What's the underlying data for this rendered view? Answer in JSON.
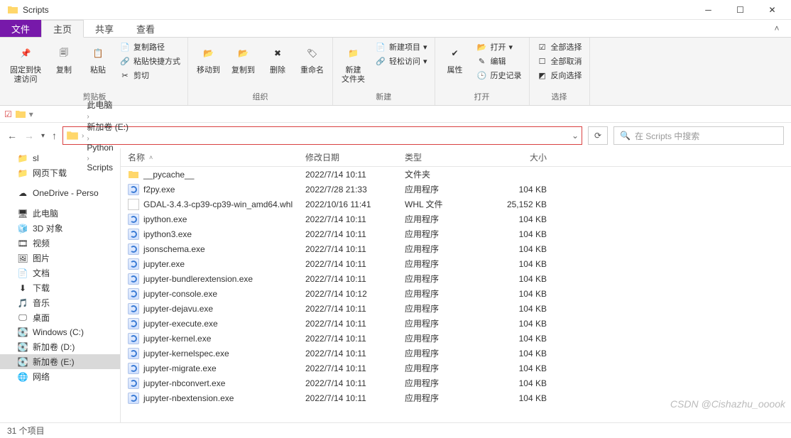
{
  "window": {
    "title": "Scripts"
  },
  "tabs": {
    "file": "文件",
    "home": "主页",
    "share": "共享",
    "view": "查看"
  },
  "ribbon": {
    "pin_quick": "固定到快\n速访问",
    "copy": "复制",
    "paste": "粘贴",
    "copy_path": "复制路径",
    "paste_shortcut": "粘贴快捷方式",
    "cut": "剪切",
    "group_clipboard": "剪贴板",
    "move_to": "移动到",
    "copy_to": "复制到",
    "delete": "删除",
    "rename": "重命名",
    "group_organize": "组织",
    "new_folder": "新建\n文件夹",
    "new_item": "新建项目",
    "easy_access": "轻松访问",
    "group_new": "新建",
    "properties": "属性",
    "open": "打开",
    "edit": "编辑",
    "history": "历史记录",
    "group_open": "打开",
    "select_all": "全部选择",
    "select_none": "全部取消",
    "invert_sel": "反向选择",
    "group_select": "选择"
  },
  "breadcrumbs": [
    "此电脑",
    "新加卷 (E:)",
    "Python",
    "Scripts"
  ],
  "search_placeholder": "在 Scripts 中搜索",
  "tree": [
    {
      "icon": "folder",
      "label": "sl"
    },
    {
      "icon": "folder",
      "label": "网页下载"
    },
    {
      "icon": "onedrive",
      "label": "OneDrive - Perso"
    },
    {
      "icon": "pc",
      "label": "此电脑"
    },
    {
      "icon": "3d",
      "label": "3D 对象"
    },
    {
      "icon": "video",
      "label": "视频"
    },
    {
      "icon": "pictures",
      "label": "图片"
    },
    {
      "icon": "docs",
      "label": "文档"
    },
    {
      "icon": "downloads",
      "label": "下载"
    },
    {
      "icon": "music",
      "label": "音乐"
    },
    {
      "icon": "desktop",
      "label": "桌面"
    },
    {
      "icon": "drive",
      "label": "Windows (C:)"
    },
    {
      "icon": "drive",
      "label": "新加卷 (D:)"
    },
    {
      "icon": "drive",
      "label": "新加卷 (E:)",
      "selected": true
    },
    {
      "icon": "network",
      "label": "网络"
    }
  ],
  "columns": {
    "name": "名称",
    "date": "修改日期",
    "type": "类型",
    "size": "大小"
  },
  "files": [
    {
      "icon": "folder",
      "name": "__pycache__",
      "date": "2022/7/14 10:11",
      "type": "文件夹",
      "size": ""
    },
    {
      "icon": "exe",
      "name": "f2py.exe",
      "date": "2022/7/28 21:33",
      "type": "应用程序",
      "size": "104 KB"
    },
    {
      "icon": "whl",
      "name": "GDAL-3.4.3-cp39-cp39-win_amd64.whl",
      "date": "2022/10/16 11:41",
      "type": "WHL 文件",
      "size": "25,152 KB"
    },
    {
      "icon": "exe",
      "name": "ipython.exe",
      "date": "2022/7/14 10:11",
      "type": "应用程序",
      "size": "104 KB"
    },
    {
      "icon": "exe",
      "name": "ipython3.exe",
      "date": "2022/7/14 10:11",
      "type": "应用程序",
      "size": "104 KB"
    },
    {
      "icon": "exe",
      "name": "jsonschema.exe",
      "date": "2022/7/14 10:11",
      "type": "应用程序",
      "size": "104 KB"
    },
    {
      "icon": "exe",
      "name": "jupyter.exe",
      "date": "2022/7/14 10:11",
      "type": "应用程序",
      "size": "104 KB"
    },
    {
      "icon": "exe",
      "name": "jupyter-bundlerextension.exe",
      "date": "2022/7/14 10:11",
      "type": "应用程序",
      "size": "104 KB"
    },
    {
      "icon": "exe",
      "name": "jupyter-console.exe",
      "date": "2022/7/14 10:12",
      "type": "应用程序",
      "size": "104 KB"
    },
    {
      "icon": "exe",
      "name": "jupyter-dejavu.exe",
      "date": "2022/7/14 10:11",
      "type": "应用程序",
      "size": "104 KB"
    },
    {
      "icon": "exe",
      "name": "jupyter-execute.exe",
      "date": "2022/7/14 10:11",
      "type": "应用程序",
      "size": "104 KB"
    },
    {
      "icon": "exe",
      "name": "jupyter-kernel.exe",
      "date": "2022/7/14 10:11",
      "type": "应用程序",
      "size": "104 KB"
    },
    {
      "icon": "exe",
      "name": "jupyter-kernelspec.exe",
      "date": "2022/7/14 10:11",
      "type": "应用程序",
      "size": "104 KB"
    },
    {
      "icon": "exe",
      "name": "jupyter-migrate.exe",
      "date": "2022/7/14 10:11",
      "type": "应用程序",
      "size": "104 KB"
    },
    {
      "icon": "exe",
      "name": "jupyter-nbconvert.exe",
      "date": "2022/7/14 10:11",
      "type": "应用程序",
      "size": "104 KB"
    },
    {
      "icon": "exe",
      "name": "jupyter-nbextension.exe",
      "date": "2022/7/14 10:11",
      "type": "应用程序",
      "size": "104 KB"
    }
  ],
  "status": "31 个项目",
  "watermark": "CSDN @Cishazhu_ooook"
}
